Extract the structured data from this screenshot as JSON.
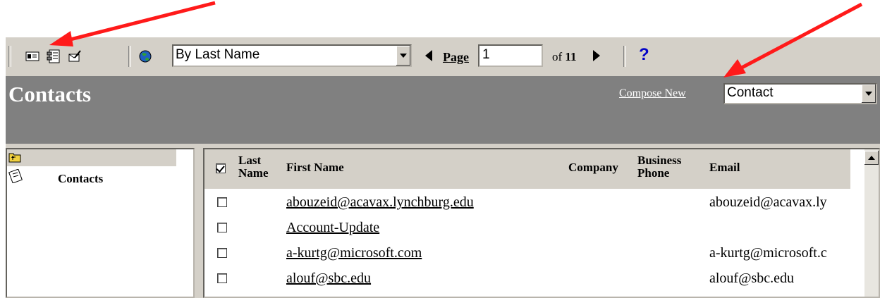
{
  "toolbar": {
    "view_select": "By Last Name",
    "page_label": "Page",
    "page_value": "1",
    "of_prefix": "of",
    "page_total": "11",
    "help_label": "?"
  },
  "header": {
    "title": "Contacts",
    "compose_label": "Compose New",
    "compose_select": "Contact"
  },
  "folders": {
    "items": [
      {
        "label": ""
      },
      {
        "label": "Contacts"
      }
    ]
  },
  "grid": {
    "columns": {
      "last_name": "Last Name",
      "last_line1": "Last",
      "last_line2": "Name",
      "first_name": "First Name",
      "company": "Company",
      "business_line1": "Business",
      "business_line2": "Phone",
      "email": "Email"
    },
    "rows": [
      {
        "name": "abouzeid@acavax.lynchburg.edu",
        "email": "abouzeid@acavax.ly"
      },
      {
        "name": "Account-Update",
        "email": ""
      },
      {
        "name": "a-kurtg@microsoft.com",
        "email": "a-kurtg@microsoft.c"
      },
      {
        "name": "alouf@sbc.edu",
        "email": "alouf@sbc.edu"
      }
    ]
  },
  "colors": {
    "annotation_arrow": "#ff1a1a",
    "header_bg": "#808080",
    "chrome": "#d4d0c8",
    "help": "#0000c8"
  }
}
